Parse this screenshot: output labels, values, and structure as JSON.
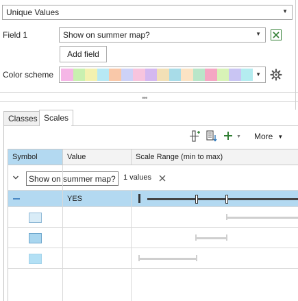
{
  "primary_symbology": {
    "selected": "Unique Values"
  },
  "field1": {
    "label": "Field 1",
    "value": "Show on summer map?"
  },
  "add_field": {
    "label": "Add field"
  },
  "color_scheme": {
    "label": "Color scheme",
    "colors": [
      "#f5b6e6",
      "#c9f0b0",
      "#f3f1b0",
      "#b7e8f4",
      "#f9c8a9",
      "#cdd2f7",
      "#f7c4de",
      "#d4b8f0",
      "#f2e0b6",
      "#a8dce8",
      "#fbe3c4",
      "#b9e6c9",
      "#f5a7c3",
      "#d8f3b7",
      "#c9c5f3",
      "#b4ecf0"
    ]
  },
  "tabs": [
    {
      "label": "Classes"
    },
    {
      "label": "Scales"
    }
  ],
  "toolbar": {
    "more_label": "More"
  },
  "table": {
    "headers": {
      "symbol": "Symbol",
      "value": "Value",
      "scale_range": "Scale Range (min to max)"
    },
    "group": {
      "field": "Show on summer map?",
      "count": "1 values"
    },
    "rows": [
      {
        "value": "YES",
        "symbol_color": "",
        "range_min": 0.0,
        "range_max": 1.0
      },
      {
        "value": "",
        "symbol_color": "#d9ecf7",
        "range_min": 0.62,
        "range_max": 1.0
      },
      {
        "value": "",
        "symbol_color": "#a9d6ef",
        "range_min": 0.42,
        "range_max": 0.62
      },
      {
        "value": "",
        "symbol_color": "#b3e0f5",
        "range_min": 0.03,
        "range_max": 0.42
      }
    ]
  }
}
